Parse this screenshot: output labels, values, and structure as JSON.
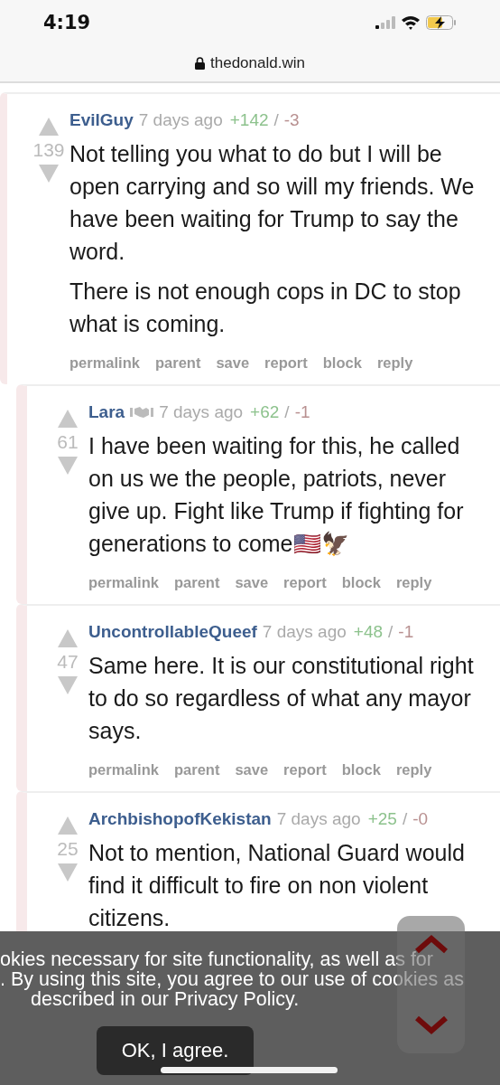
{
  "status_bar": {
    "time": "4:19"
  },
  "address_bar": {
    "url": "thedonald.win"
  },
  "comments": [
    {
      "author": "EvilGuy",
      "badge": false,
      "time": "7 days ago",
      "up": "+142",
      "sep": "/",
      "down": "-3",
      "score": "139",
      "paragraphs": [
        "Not telling you what to do but I will be open carrying and so will my friends. We have been waiting for Trump to say the word.",
        "There is not enough cops in DC to stop what is coming."
      ],
      "actions": [
        "permalink",
        "parent",
        "save",
        "report",
        "block",
        "reply"
      ],
      "children": [
        {
          "author": "Lara",
          "badge": true,
          "time": "7 days ago",
          "up": "+62",
          "sep": "/",
          "down": "-1",
          "score": "61",
          "paragraphs": [
            "I have been waiting for this, he called on us we the people, patriots, never give up. Fight like Trump if fighting for generations to come🇺🇸🦅"
          ],
          "actions": [
            "permalink",
            "parent",
            "save",
            "report",
            "block",
            "reply"
          ]
        },
        {
          "author": "UncontrollableQueef",
          "badge": false,
          "time": "7 days ago",
          "up": "+48",
          "sep": "/",
          "down": "-1",
          "score": "47",
          "paragraphs": [
            "Same here. It is our constitutional right to do so regardless of what any mayor says."
          ],
          "actions": [
            "permalink",
            "parent",
            "save",
            "report",
            "block",
            "reply"
          ]
        },
        {
          "author": "ArchbishopofKekistan",
          "badge": false,
          "time": "7 days ago",
          "up": "+25",
          "sep": "/",
          "down": "-0",
          "score": "25",
          "paragraphs": [
            "Not to mention, National Guard would find it difficult to fire on non violent citizens."
          ]
        }
      ]
    }
  ],
  "cookie_banner": {
    "lines": [
      "okies necessary for site functionality, as well as for",
      ". By using this site, you agree to our use of cookies as",
      "described in our Privacy Policy."
    ],
    "button": "OK, I agree."
  }
}
